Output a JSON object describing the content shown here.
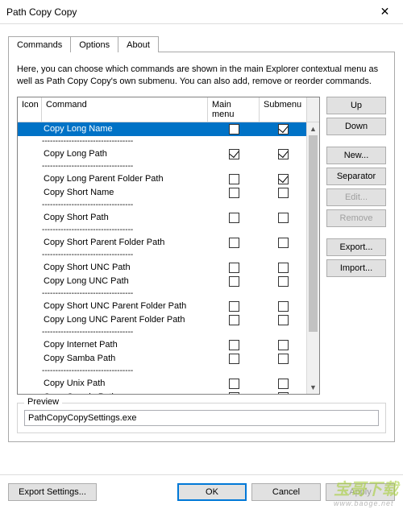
{
  "window": {
    "title": "Path Copy Copy",
    "close_glyph": "✕"
  },
  "tabs": {
    "commands": "Commands",
    "options": "Options",
    "about": "About"
  },
  "description": "Here, you can choose which commands are shown in the main Explorer contextual menu as well as Path Copy Copy's own submenu. You can also add, remove or reorder commands.",
  "headers": {
    "icon": "Icon",
    "command": "Command",
    "main_menu": "Main menu",
    "submenu": "Submenu"
  },
  "separator_text": "----------------------------------",
  "rows": [
    {
      "type": "cmd",
      "label": "Copy Long Name",
      "mm": false,
      "sm": true,
      "selected": true
    },
    {
      "type": "sep"
    },
    {
      "type": "cmd",
      "label": "Copy Long Path",
      "mm": true,
      "sm": true
    },
    {
      "type": "sep"
    },
    {
      "type": "cmd",
      "label": "Copy Long Parent Folder Path",
      "mm": false,
      "sm": true
    },
    {
      "type": "cmd",
      "label": "Copy Short Name",
      "mm": false,
      "sm": false
    },
    {
      "type": "sep"
    },
    {
      "type": "cmd",
      "label": "Copy Short Path",
      "mm": false,
      "sm": false
    },
    {
      "type": "sep"
    },
    {
      "type": "cmd",
      "label": "Copy Short Parent Folder Path",
      "mm": false,
      "sm": false
    },
    {
      "type": "sep"
    },
    {
      "type": "cmd",
      "label": "Copy Short UNC Path",
      "mm": false,
      "sm": false
    },
    {
      "type": "cmd",
      "label": "Copy Long UNC Path",
      "mm": false,
      "sm": false
    },
    {
      "type": "sep"
    },
    {
      "type": "cmd",
      "label": "Copy Short UNC Parent Folder Path",
      "mm": false,
      "sm": false
    },
    {
      "type": "cmd",
      "label": "Copy Long UNC Parent Folder Path",
      "mm": false,
      "sm": false
    },
    {
      "type": "sep"
    },
    {
      "type": "cmd",
      "label": "Copy Internet Path",
      "mm": false,
      "sm": false
    },
    {
      "type": "cmd",
      "label": "Copy Samba Path",
      "mm": false,
      "sm": false
    },
    {
      "type": "sep"
    },
    {
      "type": "cmd",
      "label": "Copy Unix Path",
      "mm": false,
      "sm": false
    },
    {
      "type": "cmd",
      "label": "Copy Cygwin Path",
      "mm": false,
      "sm": false
    }
  ],
  "side_buttons": {
    "up": "Up",
    "down": "Down",
    "new": "New...",
    "separator": "Separator",
    "edit": "Edit...",
    "remove": "Remove",
    "export": "Export...",
    "import": "Import..."
  },
  "preview": {
    "legend": "Preview",
    "value": "PathCopyCopySettings.exe"
  },
  "bottom": {
    "export_settings": "Export Settings...",
    "ok": "OK",
    "cancel": "Cancel",
    "apply": "Apply"
  },
  "watermark": {
    "main": "宝哥下载",
    "sub": "www.baoge.net"
  }
}
